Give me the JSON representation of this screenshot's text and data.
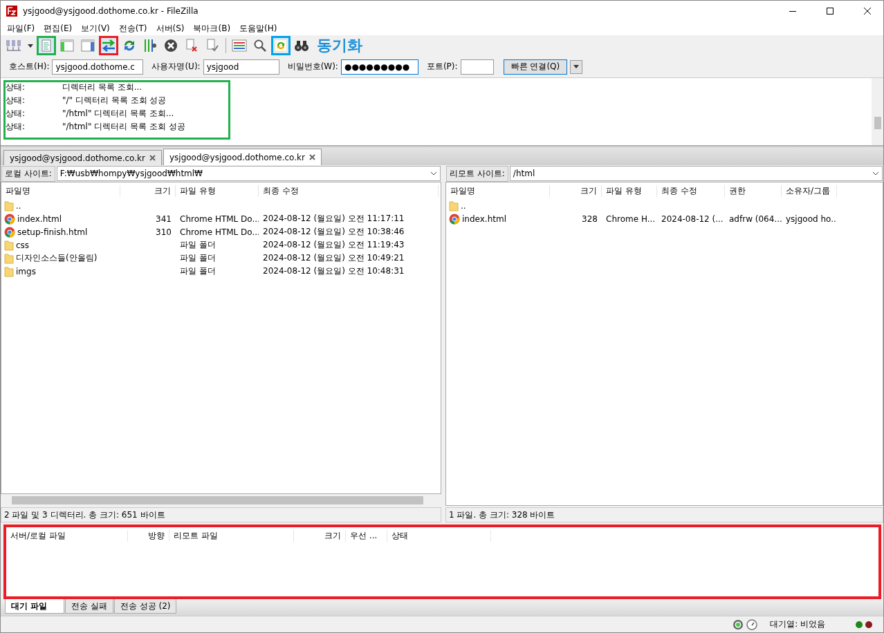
{
  "window": {
    "title": "ysjgood@ysjgood.dothome.co.kr - FileZilla"
  },
  "menu": [
    "파일(F)",
    "편집(E)",
    "보기(V)",
    "전송(T)",
    "서버(S)",
    "북마크(B)",
    "도움말(H)"
  ],
  "toolbar": [
    {
      "kind": "site-manager"
    },
    {
      "kind": "dropdown"
    },
    {
      "kind": "message-log",
      "annotated": true
    },
    {
      "kind": "local-tree"
    },
    {
      "kind": "remote-tree"
    },
    {
      "kind": "queue",
      "annotated": true
    },
    {
      "kind": "refresh"
    },
    {
      "kind": "filter"
    },
    {
      "kind": "cancel"
    },
    {
      "kind": "disconnect"
    },
    {
      "kind": "reconnect"
    },
    {
      "kind": "separator"
    },
    {
      "kind": "compare"
    },
    {
      "kind": "search-remote"
    },
    {
      "kind": "sync",
      "annotated": true
    },
    {
      "kind": "binoculars"
    }
  ],
  "annotation": {
    "text": "동기화"
  },
  "quickconnect": {
    "host_label": "호스트(H):",
    "host": "ysjgood.dothome.c",
    "user_label": "사용자명(U):",
    "user": "ysjgood",
    "password_label": "비밀번호(W):",
    "password": "●●●●●●●●●",
    "port_label": "포트(P):",
    "connect": "빠른 연결(Q)"
  },
  "log": {
    "annotated": true,
    "lines": [
      {
        "label": "상태:",
        "message": "디렉터리 목록 조회..."
      },
      {
        "label": "상태:",
        "message": "\"/\" 디렉터리 목록 조회 성공"
      },
      {
        "label": "상태:",
        "message": "\"/html\" 디렉터리 목록 조회..."
      },
      {
        "label": "상태:",
        "message": "\"/html\" 디렉터리 목록 조회 성공"
      }
    ]
  },
  "tabs": [
    {
      "label": "ysjgood@ysjgood.dothome.co.kr",
      "selected": false
    },
    {
      "label": "ysjgood@ysjgood.dothome.co.kr",
      "selected": true
    }
  ],
  "local": {
    "label": "로컬 사이트:",
    "path": "F:₩usb₩hompy₩ysjgood₩html₩",
    "columns": [
      "파일명",
      "크기",
      "파일 유형",
      "최종 수정"
    ],
    "rows": [
      {
        "kind": "folder",
        "cells": [
          "..",
          "",
          "",
          ""
        ]
      },
      {
        "kind": "html",
        "cells": [
          "index.html",
          "341",
          "Chrome HTML Do...",
          "2024-08-12 (월요일) 오전 11:17:11"
        ]
      },
      {
        "kind": "html",
        "cells": [
          "setup-finish.html",
          "310",
          "Chrome HTML Do...",
          "2024-08-12 (월요일) 오전 10:38:46"
        ]
      },
      {
        "kind": "folder",
        "cells": [
          "css",
          "",
          "파일 폴더",
          "2024-08-12 (월요일) 오전 11:19:43"
        ]
      },
      {
        "kind": "folder",
        "cells": [
          "디자인소스들(안올림)",
          "",
          "파일 폴더",
          "2024-08-12 (월요일) 오전 10:49:21"
        ]
      },
      {
        "kind": "folder",
        "cells": [
          "imgs",
          "",
          "파일 폴더",
          "2024-08-12 (월요일) 오전 10:48:31"
        ]
      }
    ],
    "status": "2 파일 및 3 디렉터리. 총 크기: 651 바이트"
  },
  "remote": {
    "label": "리모트 사이트:",
    "path": "/html",
    "columns": [
      "파일명",
      "크기",
      "파일 유형",
      "최종 수정",
      "권한",
      "소유자/그룹"
    ],
    "rows": [
      {
        "kind": "folder",
        "cells": [
          "..",
          "",
          "",
          "",
          "",
          ""
        ]
      },
      {
        "kind": "html",
        "cells": [
          "index.html",
          "328",
          "Chrome H...",
          "2024-08-12 (...",
          "adfrw (064...",
          "ysjgood ho..."
        ]
      }
    ],
    "status": "1 파일. 총 크기: 328 바이트"
  },
  "queue": {
    "annotated": true,
    "columns": [
      "서버/로컬 파일",
      "방향",
      "리모트 파일",
      "크기",
      "우선 ...",
      "상태"
    ]
  },
  "queue_tabs": [
    {
      "label": "대기 파일",
      "selected": true
    },
    {
      "label": "전송 실패",
      "selected": false
    },
    {
      "label": "전송 성공 (2)",
      "selected": false
    }
  ],
  "status_bar": {
    "queue": "대기열: 비었음"
  }
}
